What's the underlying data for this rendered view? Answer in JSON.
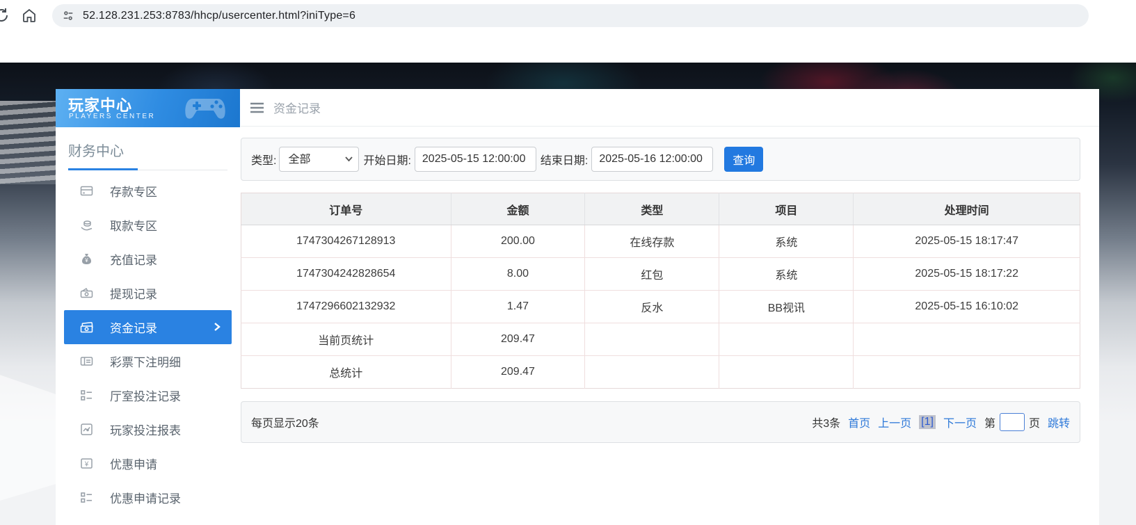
{
  "browser": {
    "url": "52.128.231.253:8783/hhcp/usercenter.html?iniType=6"
  },
  "sidebar": {
    "title": "玩家中心",
    "subtitle": "PLAYERS CENTER",
    "section": "财务中心",
    "items": [
      {
        "label": "存款专区",
        "icon": "deposit-card-icon",
        "active": false
      },
      {
        "label": "取款专区",
        "icon": "withdraw-hand-icon",
        "active": false
      },
      {
        "label": "充值记录",
        "icon": "moneybag-icon",
        "active": false
      },
      {
        "label": "提现记录",
        "icon": "banknote-icon",
        "active": false
      },
      {
        "label": "资金记录",
        "icon": "funds-icon",
        "active": true
      },
      {
        "label": "彩票下注明细",
        "icon": "ticket-icon",
        "active": false
      },
      {
        "label": "厅室投注记录",
        "icon": "list-icon",
        "active": false
      },
      {
        "label": "玩家投注报表",
        "icon": "chart-icon",
        "active": false
      },
      {
        "label": "优惠申请",
        "icon": "promo-icon",
        "active": false
      },
      {
        "label": "优惠申请记录",
        "icon": "list-icon",
        "active": false
      }
    ]
  },
  "main": {
    "page_title": "资金记录",
    "filter": {
      "type_label": "类型:",
      "type_value": "全部",
      "start_label": "开始日期:",
      "start_value": "2025-05-15 12:00:00",
      "end_label": "结束日期:",
      "end_value": "2025-05-16 12:00:00",
      "search_label": "查询"
    },
    "table": {
      "headers": [
        "订单号",
        "金额",
        "类型",
        "项目",
        "处理时间"
      ],
      "rows": [
        [
          "1747304267128913",
          "200.00",
          "在线存款",
          "系统",
          "2025-05-15 18:17:47"
        ],
        [
          "1747304242828654",
          "8.00",
          "红包",
          "系统",
          "2025-05-15 18:17:22"
        ],
        [
          "1747296602132932",
          "1.47",
          "反水",
          "BB视讯",
          "2025-05-15 16:10:02"
        ],
        [
          "当前页统计",
          "209.47",
          "",
          "",
          ""
        ],
        [
          "总统计",
          "209.47",
          "",
          "",
          ""
        ]
      ]
    },
    "pagination": {
      "page_size_text": "每页显示20条",
      "total_text": "共3条",
      "first_label": "首页",
      "prev_label": "上一页",
      "current_page": "[1]",
      "next_label": "下一页",
      "jump_prefix": "第",
      "jump_suffix": "页",
      "jump_label": "跳转",
      "jump_value": ""
    }
  },
  "colors": {
    "accent_blue": "#2a82e2",
    "button_blue": "#2279e0",
    "link_blue": "#2e79d9",
    "sidebar_header_gradient_start": "#5db0f2",
    "sidebar_header_gradient_end": "#1c77cf",
    "table_header_bg": "#f1f2f3",
    "table_border_pink": "#efdede"
  }
}
